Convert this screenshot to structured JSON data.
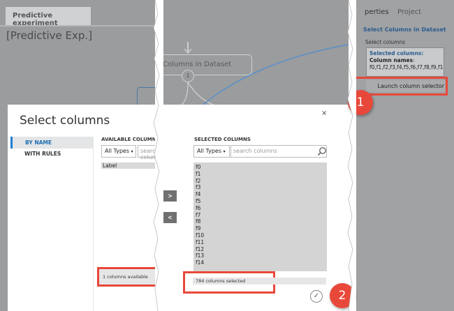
{
  "left_panel": {
    "tab_label": "Predictive experiment",
    "experiment_title": "[Predictive Exp.]"
  },
  "canvas": {
    "module_label": "Columns in Dataset",
    "port_number": "1"
  },
  "properties_panel": {
    "tab_properties": "perties",
    "tab_project": "Project",
    "module_title": "Select Columns in Dataset",
    "select_columns_label": "Select columns",
    "selected_columns_heading": "Selected columns:",
    "column_names_label": "Column names",
    "column_names_value": "f0,f1,f2,f3,f4,f5,f6,f7,f8,f9,f10,",
    "launch_button": "Launch column selector"
  },
  "dialog": {
    "title": "Select columns",
    "close_symbol": "×",
    "nav": [
      {
        "label": "BY NAME",
        "active": true
      },
      {
        "label": "WITH RULES",
        "active": false
      }
    ],
    "available": {
      "heading": "AVAILABLE COLUMNS",
      "type_filter": "All Types",
      "search_placeholder": "search columns",
      "items": [
        "Label"
      ],
      "count_text": "1 columns available"
    },
    "move_right_label": ">",
    "move_left_label": "<",
    "selected": {
      "heading": "SELECTED COLUMNS",
      "type_filter": "All Types",
      "search_placeholder": "search columns",
      "items": [
        "f0",
        "f1",
        "f2",
        "f3",
        "f4",
        "f5",
        "f6",
        "f7",
        "f8",
        "f9",
        "f10",
        "f11",
        "f12",
        "f13",
        "f14"
      ],
      "count_text": "784 columns selected"
    },
    "ok_symbol": "✓"
  },
  "callouts": [
    "1",
    "2"
  ],
  "colors": {
    "callout_red": "#e8483a",
    "accent_blue": "#1e7fd0",
    "overlay_gray": "#9a9c9e"
  }
}
